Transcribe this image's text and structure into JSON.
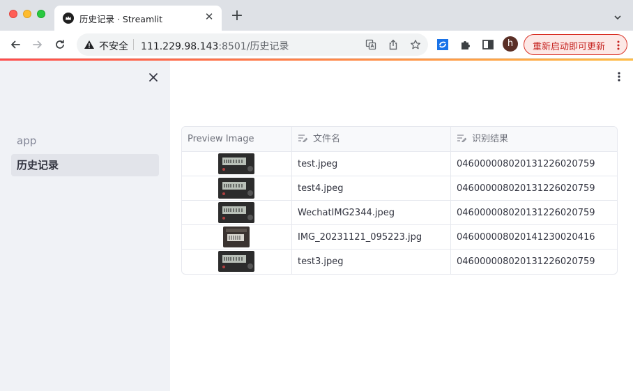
{
  "browser": {
    "tab_title": "历史记录 · Streamlit",
    "address_insecure_label": "不安全",
    "address_host": "111.229.98.143",
    "address_rest": ":8501/历史记录",
    "profile_initial": "h",
    "update_button_label": "重新启动即可更新"
  },
  "sidebar": {
    "items": [
      {
        "label": "app"
      },
      {
        "label": "历史记录"
      }
    ]
  },
  "table": {
    "columns": [
      "Preview Image",
      "文件名",
      "识别结果"
    ],
    "rows": [
      {
        "filename": "test.jpeg",
        "result": "046000008020131226020759"
      },
      {
        "filename": "test4.jpeg",
        "result": "046000008020131226020759"
      },
      {
        "filename": "WechatIMG2344.jpeg",
        "result": "046000008020131226020759"
      },
      {
        "filename": "IMG_20231121_095223.jpg",
        "result": "046000008020141230020416"
      },
      {
        "filename": "test3.jpeg",
        "result": "046000008020131226020759"
      }
    ]
  },
  "colors": {
    "accent_start": "#ff4b4b",
    "accent_end": "#ffbd45",
    "sidebar_bg": "#f0f2f6"
  }
}
